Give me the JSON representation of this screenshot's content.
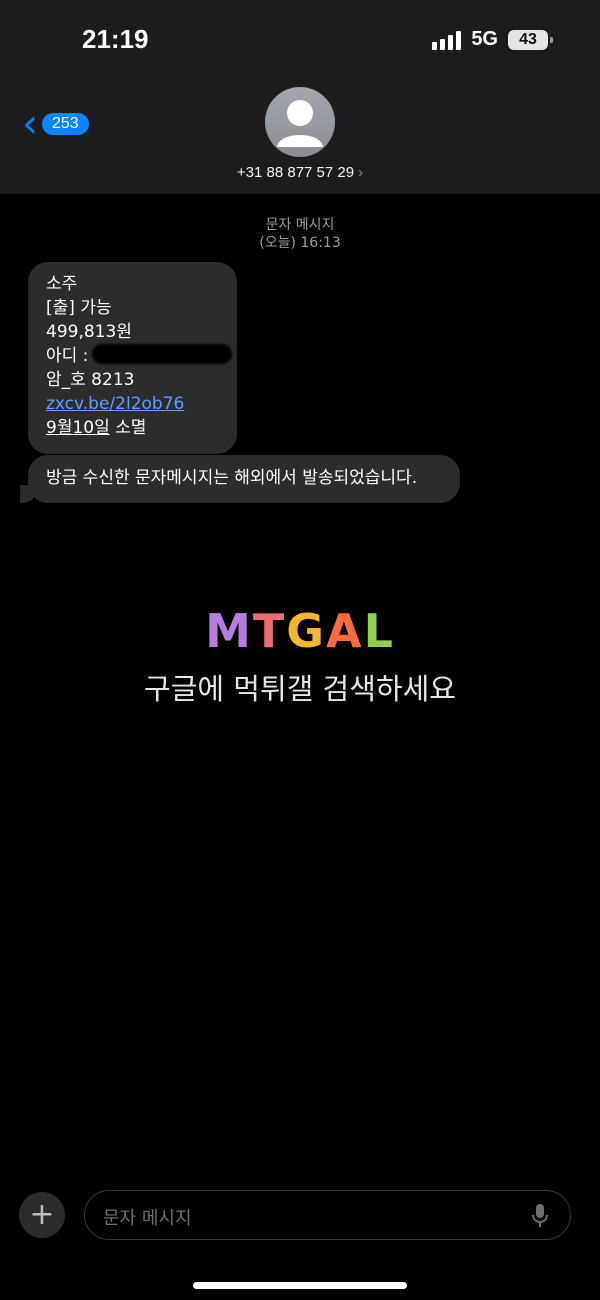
{
  "status": {
    "time": "21:19",
    "network": "5G",
    "battery": "43"
  },
  "header": {
    "back_count": "253",
    "contact_number": "+31 88 877 57 29",
    "chevron": "›"
  },
  "thread": {
    "meta_label": "문자 메시지",
    "meta_time": "(오늘) 16:13",
    "message1": {
      "line1": "소주",
      "line2": "[출] 가능",
      "line3": "499,813원",
      "line4_prefix": "아디 :",
      "line5": "암_호 8213",
      "link": "zxcv.be/2l2ob76",
      "expiry_date": "9월10일",
      "expiry_suffix": " 소멸"
    },
    "message2": "방금 수신한 문자메시지는 해외에서 발송되었습니다."
  },
  "watermark": {
    "logo_letters": [
      "M",
      "T",
      "G",
      "A",
      "L"
    ],
    "text": "구글에 먹튀갤 검색하세요"
  },
  "input": {
    "placeholder": "문자 메시지",
    "plus": "+"
  },
  "icons": [
    "back-chevron-icon",
    "avatar-icon",
    "plus-icon",
    "mic-icon",
    "signal-icon",
    "battery-icon"
  ],
  "colors": {
    "accent": "#0a84ff",
    "bubble": "#2c2c2e",
    "link": "#5ea0ff",
    "header_bg": "#1c1c1e"
  }
}
